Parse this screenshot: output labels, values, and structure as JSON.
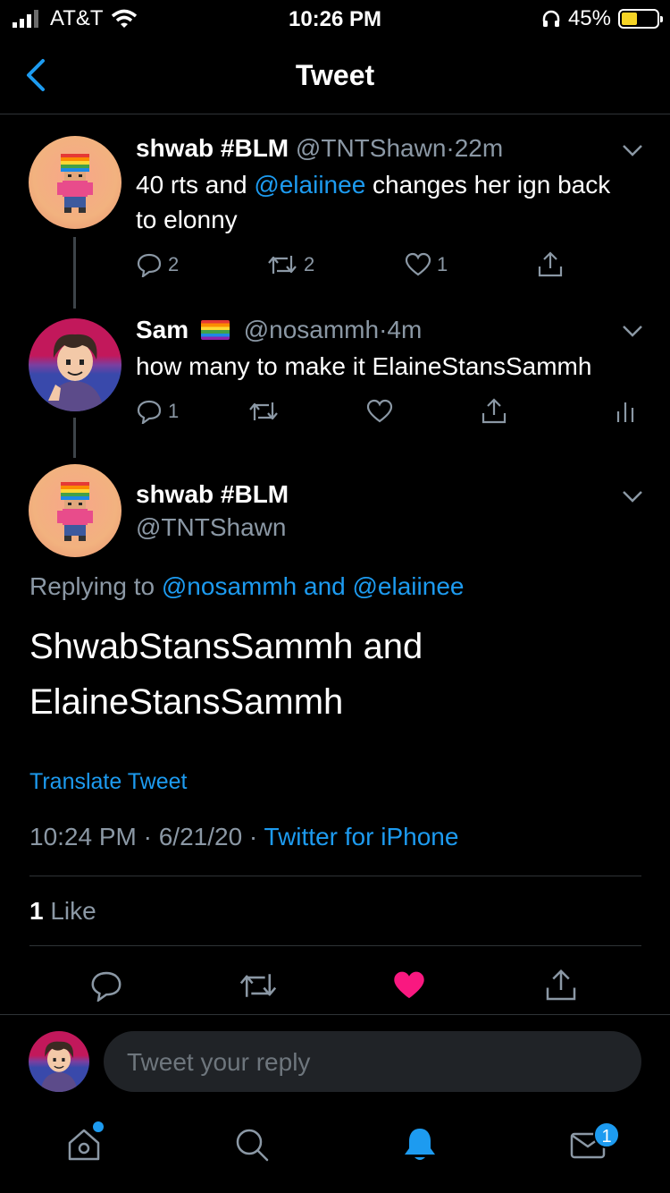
{
  "status_bar": {
    "carrier": "AT&T",
    "time": "10:26 PM",
    "battery": "45%",
    "battery_level": 0.45
  },
  "nav": {
    "title": "Tweet",
    "back_icon": "chevron-left-icon"
  },
  "thread": [
    {
      "name": "shwab #BLM",
      "handle": "@TNTShawn",
      "sep": "·",
      "age": "22m",
      "text_parts": [
        "40 rts and ",
        "@elaiinee",
        " changes her ign back to elonny"
      ],
      "reply_count": "2",
      "retweet_count": "2",
      "like_count": "1"
    },
    {
      "name": "Sam",
      "handle": "@nosammh",
      "sep": "·",
      "age": "4m",
      "text": "how many to make it ElaineStansSammh",
      "reply_count": "1",
      "retweet_count": "",
      "like_count": ""
    }
  ],
  "main_tweet": {
    "name": "shwab #BLM",
    "handle": "@TNTShawn",
    "replying_prefix": "Replying to ",
    "replying_to": "@nosammh and @elaiinee",
    "text_line1": "ShwabStansSammh and",
    "text_line2": "ElaineStansSammh",
    "translate": "Translate Tweet",
    "timestamp": "10:24 PM · 6/21/20 · ",
    "source": "Twitter for iPhone",
    "likes_count": "1",
    "likes_label": " Like"
  },
  "reply_box": {
    "placeholder": "Tweet your reply"
  },
  "tabbar": {
    "items": [
      "home-icon",
      "search-icon",
      "notifications-icon",
      "messages-icon"
    ],
    "messages_badge": "1"
  },
  "colors": {
    "accent": "#1d9bf0",
    "like": "#f91880",
    "background": "#000000"
  }
}
